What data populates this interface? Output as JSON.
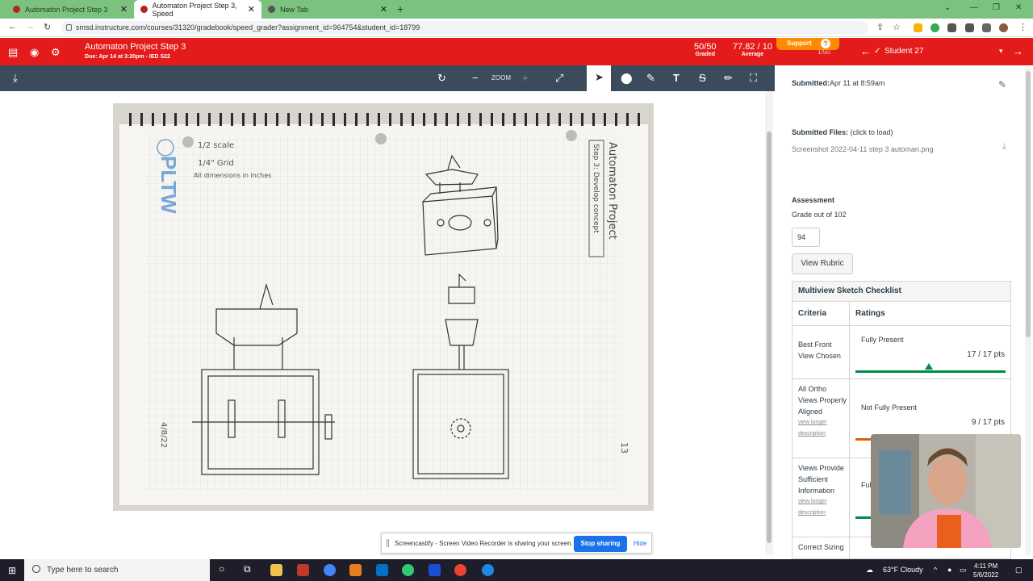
{
  "browser": {
    "tabs": [
      {
        "title": "Automaton Project Step 3",
        "active": false
      },
      {
        "title": "Automaton Project Step 3, Speed",
        "active": true
      },
      {
        "title": "New Tab",
        "active": false
      }
    ],
    "url": "smsd.instructure.com/courses/31320/gradebook/speed_grader?assignment_id=964754&student_id=18799"
  },
  "header": {
    "assignment_title": "Automaton Project Step 3",
    "due": "Due: Apr 14 at 3:20pm - IED S22",
    "graded_value": "50/50",
    "graded_label": "Graded",
    "average_value": "77.82 / 10",
    "average_label": "Average",
    "support_label": "Support",
    "student_count": "1/50",
    "student_name": "Student 27"
  },
  "toolbar": {
    "zoom_label": "ZOOM"
  },
  "notebook": {
    "scale": "1/2 scale",
    "grid": "1/4\" Grid",
    "dims": "All dimensions in inches",
    "title1": "Automaton Project",
    "title2": "Step 3: Develop concept",
    "brand": "PLTW",
    "date": "4/8/22",
    "page": "13"
  },
  "submission": {
    "submitted_label": "Submitted:",
    "submitted_value": "Apr 11 at 8:59am",
    "files_label": "Submitted Files:",
    "files_hint": "(click to load)",
    "file_name": "Screenshot 2022-04-11 step 3 automan.png",
    "assessment_label": "Assessment",
    "grade_out_of": "Grade out of 102",
    "grade_value": "94",
    "view_rubric": "View Rubric"
  },
  "rubric": {
    "title": "Multiview Sketch Checklist",
    "col_criteria": "Criteria",
    "col_ratings": "Ratings",
    "rows": [
      {
        "criteria": "Best Front View Chosen",
        "rating": "Fully Present",
        "points": "17 / 17 pts",
        "link": ""
      },
      {
        "criteria": "All Ortho Views Properly Aligned",
        "rating": "Not Fully Present",
        "points": "9 / 17 pts",
        "link": "view longer description"
      },
      {
        "criteria": "Views Provide Sufficient Information",
        "rating": "Ful",
        "points": "",
        "link": "view longer description"
      },
      {
        "criteria": "Correct Sizing",
        "rating": "",
        "points": "",
        "link": ""
      }
    ],
    "colors": {
      "full": "#008a4a",
      "partial": "#e66000"
    }
  },
  "screencastify": {
    "message": "Screencastify - Screen Video Recorder is sharing your screen.",
    "stop": "Stop sharing",
    "hide": "Hide"
  },
  "taskbar": {
    "search_placeholder": "Type here to search",
    "weather": "63°F Cloudy",
    "time": "4:11 PM",
    "date": "5/6/2022"
  },
  "colors": {
    "canvas_red": "#e41b1b",
    "toolbar": "#3b4b5b",
    "tabstrip": "#7cc27f"
  }
}
